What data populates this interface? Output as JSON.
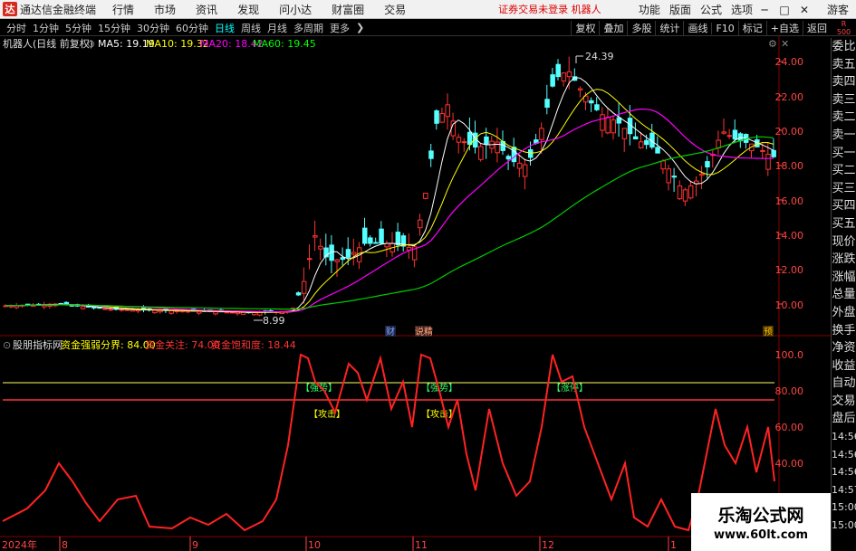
{
  "menubar": {
    "logo": "达",
    "app_title": "通达信金融终端",
    "items": [
      "行情",
      "市场",
      "资讯",
      "发现",
      "问小达",
      "财富圈",
      "交易"
    ],
    "trade_warning": "证券交易未登录  机器人",
    "right_items": [
      "功能",
      "版面",
      "公式",
      "选项"
    ],
    "guest": "游客"
  },
  "periods": [
    "分时",
    "1分钟",
    "5分钟",
    "15分钟",
    "30分钟",
    "60分钟",
    "日线",
    "周线",
    "月线",
    "多周期",
    "更多"
  ],
  "active_period": "日线",
  "toolbar_right": [
    "复权",
    "叠加",
    "多股",
    "统计",
    "画线",
    "F10",
    "标记",
    "+自选",
    "返回"
  ],
  "r500": {
    "top": "R",
    "bottom": "500"
  },
  "chart": {
    "title": "机器人(日线 前复权)",
    "ma": [
      {
        "label": "MA5: 19.19",
        "color": "#ffffff"
      },
      {
        "label": "MA10: 19.32",
        "color": "#ffff00"
      },
      {
        "label": "MA20: 18.42",
        "color": "#ff00ff"
      },
      {
        "label": "MA60: 19.45",
        "color": "#00ff00"
      }
    ],
    "price_axis": [
      "24.00",
      "22.00",
      "20.00",
      "18.00",
      "16.00",
      "14.00",
      "12.00",
      "10.00"
    ],
    "high_label": "24.39",
    "low_label": "8.99",
    "markers": [
      "财",
      "说精",
      "预"
    ],
    "indicator_title": "股朋指标网",
    "indicator_params": [
      {
        "label": "资金强弱分界: 84.00",
        "color": "#ffff00"
      },
      {
        "label": "资金关注: 74.00",
        "color": "#ff3333"
      },
      {
        "label": "资金饱和度: 18.44",
        "color": "#ff3333"
      }
    ],
    "indicator_axis": [
      "100.0",
      "80.00",
      "60.00",
      "40.00"
    ],
    "signals": [
      "【强势】",
      "【攻击】",
      "【强势】",
      "【攻击】",
      "【涨停】"
    ],
    "date_labels": [
      "2024年",
      "8",
      "9",
      "10",
      "11",
      "12",
      "1"
    ]
  },
  "sidebar": [
    "委比",
    "卖五",
    "卖四",
    "卖三",
    "卖二",
    "卖一",
    "买一",
    "买二",
    "买三",
    "买四",
    "买五",
    "现价",
    "涨跌",
    "涨幅",
    "总量",
    "外盘",
    "换手",
    "净资",
    "收益",
    "自动",
    "交易",
    "盘后",
    "14:56",
    "14:56",
    "14:56",
    "14:57",
    "15:00",
    "15:00"
  ],
  "watermark": {
    "line1": "乐淘公式网",
    "line2": "www.60lt.com"
  }
}
